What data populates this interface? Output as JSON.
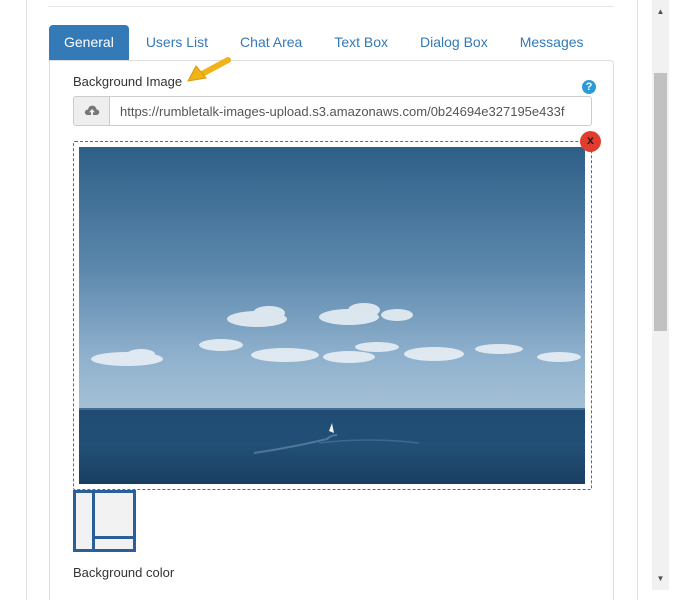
{
  "tabs": [
    {
      "label": "General",
      "active": true
    },
    {
      "label": "Users List",
      "active": false
    },
    {
      "label": "Chat Area",
      "active": false
    },
    {
      "label": "Text Box",
      "active": false
    },
    {
      "label": "Dialog Box",
      "active": false
    },
    {
      "label": "Messages",
      "active": false
    }
  ],
  "background_image": {
    "label": "Background Image",
    "url": "https://rumbletalk-images-upload.s3.amazonaws.com/0b24694e327195e433f",
    "help_icon": "question-icon",
    "upload_icon": "cloud-upload-icon",
    "remove_label": "x",
    "preview_description": "sea-and-sky-with-sailboat"
  },
  "background_color": {
    "label": "Background color"
  },
  "colors": {
    "accent": "#337ab7",
    "remove": "#e23c2e",
    "dashed_border": "#c9385c",
    "arrow": "#f0b419"
  }
}
